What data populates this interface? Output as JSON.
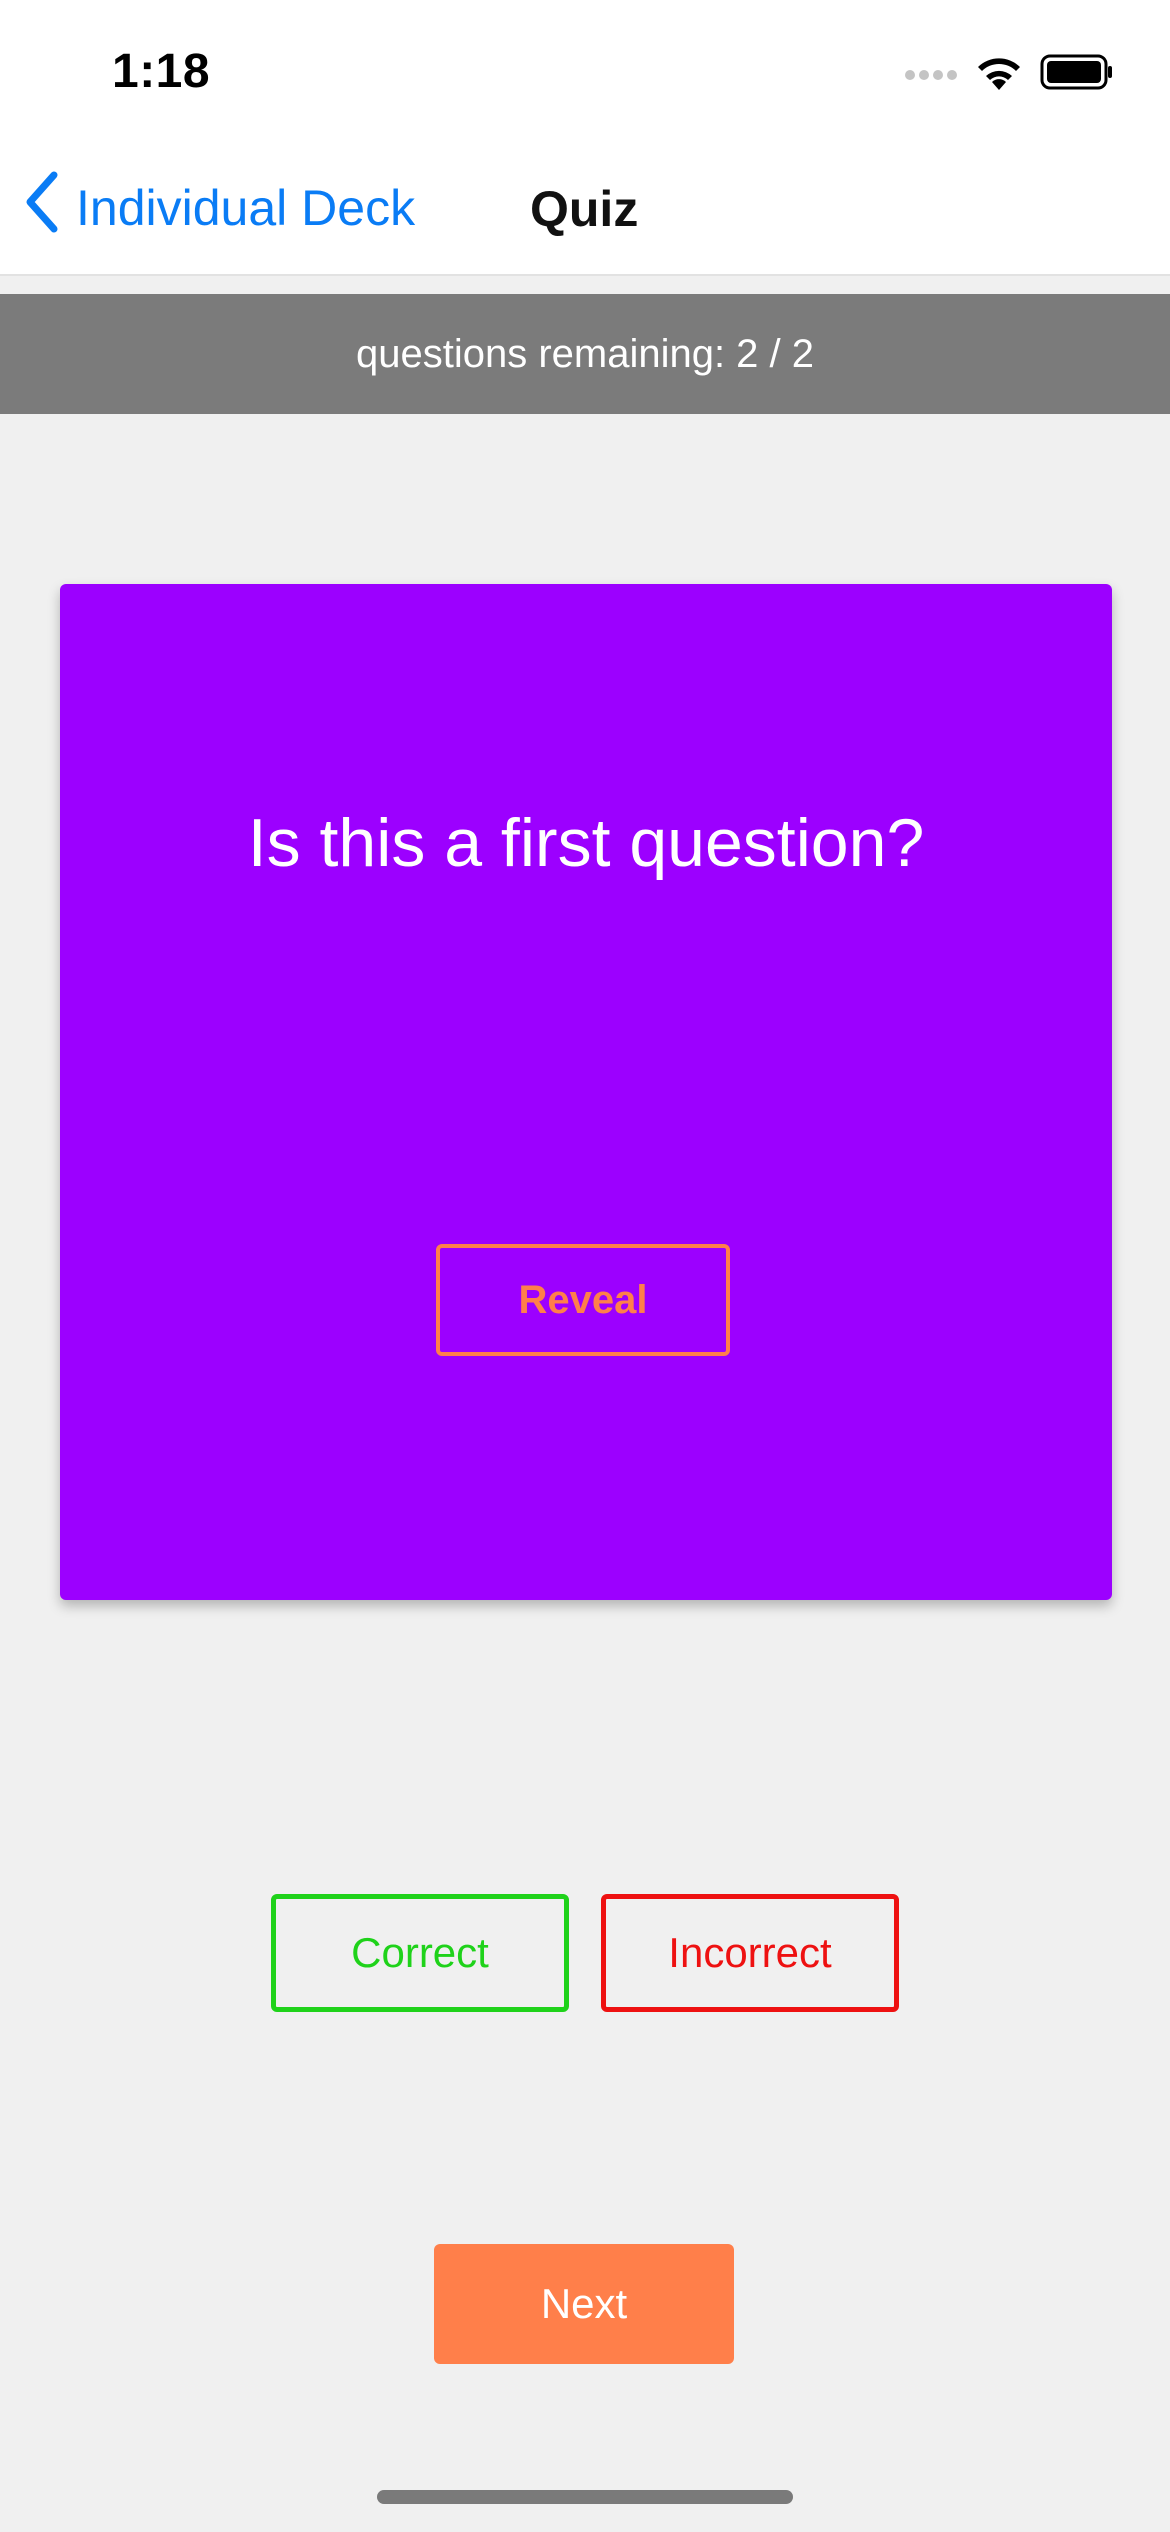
{
  "status_bar": {
    "time": "1:18",
    "icons": [
      "signal-icon",
      "wifi-icon",
      "battery-icon"
    ]
  },
  "nav": {
    "back_label": "Individual Deck",
    "title": "Quiz"
  },
  "progress": {
    "text": "questions remaining: 2 / 2"
  },
  "card": {
    "question": "Is this a first question?",
    "reveal_label": "Reveal"
  },
  "answers": {
    "correct_label": "Correct",
    "incorrect_label": "Incorrect"
  },
  "next_label": "Next",
  "colors": {
    "accent": "#0a7cf5",
    "card": "#9c00ff",
    "orange": "#ff7f4a",
    "correct": "#1fd21a",
    "incorrect": "#ee1111",
    "progress_bar": "#7b7b7b"
  }
}
